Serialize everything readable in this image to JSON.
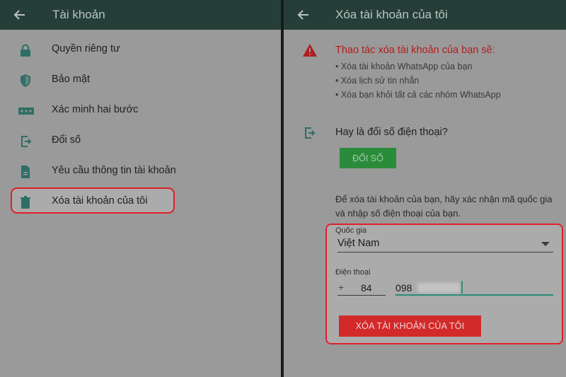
{
  "colors": {
    "header_bg": "#253f38",
    "panel_bg": "#9a9a9a",
    "icon_teal": "#2f6e66",
    "highlight_red": "#e0202a",
    "warning_red": "#b31d1d",
    "change_button_green": "#2a8c3a",
    "delete_button_red": "#d22a2a"
  },
  "left": {
    "title": "Tài khoản",
    "back_icon": "arrow-left-icon",
    "items": [
      {
        "label": "Quyền riêng tư",
        "icon": "lock-icon"
      },
      {
        "label": "Bảo mật",
        "icon": "shield-icon"
      },
      {
        "label": "Xác minh hai bước",
        "icon": "dots-icon"
      },
      {
        "label": "Đổi số",
        "icon": "change-number-icon"
      },
      {
        "label": "Yêu cầu thông tin tài khoản",
        "icon": "document-icon"
      },
      {
        "label": "Xóa tài khoản của tôi",
        "icon": "trash-icon",
        "highlighted": true
      }
    ]
  },
  "right": {
    "title": "Xóa tài khoản của tôi",
    "back_icon": "arrow-left-icon",
    "warning": {
      "icon": "warning-icon",
      "title": "Thao tác xóa tài khoản của bạn sẽ:",
      "bullets": [
        "• Xóa tài khoản WhatsApp của bạn",
        "• Xóa lịch sử tin nhắn",
        "• Xóa bạn khỏi tất cả các nhóm WhatsApp"
      ]
    },
    "change_number": {
      "icon": "change-number-icon",
      "title": "Hay là đổi số điện thoại?",
      "button": "ĐỔI SỐ"
    },
    "instruction": "Để xóa tài khoản của bạn, hãy xác nhận mã quốc gia và nhập số điện thoại của bạn.",
    "form": {
      "country_label": "Quốc gia",
      "country_value": "Việt Nam",
      "phone_label": "Điện thoại",
      "plus": "+",
      "country_code": "84",
      "phone_prefix": "098",
      "delete_button": "XÓA TÀI KHOẢN CỦA TÔI"
    }
  }
}
